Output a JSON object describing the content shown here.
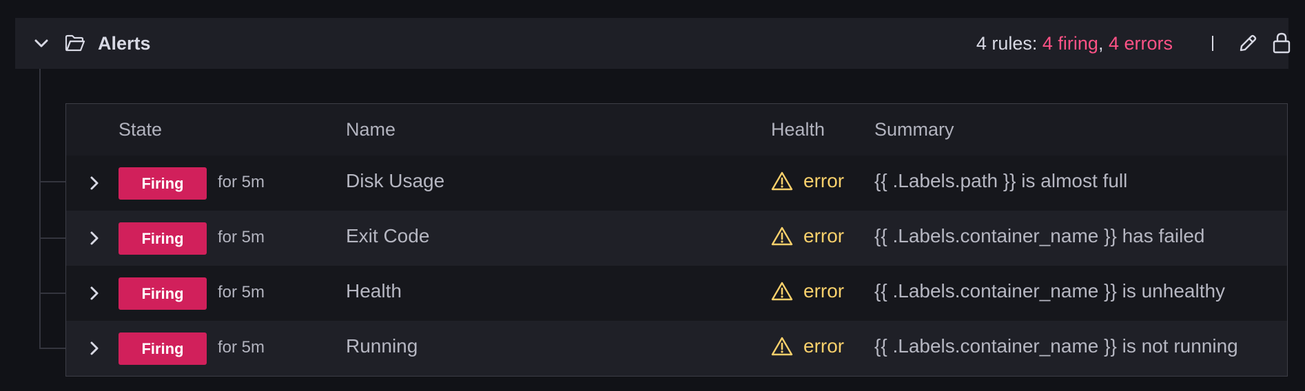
{
  "group": {
    "title": "Alerts",
    "summary_prefix": "4 rules:",
    "firing_text": "4 firing",
    "separator": ",",
    "errors_text": "4 errors"
  },
  "table": {
    "headers": {
      "state": "State",
      "name": "Name",
      "health": "Health",
      "summary": "Summary"
    },
    "rows": [
      {
        "state": "Firing",
        "duration": "for 5m",
        "name": "Disk Usage",
        "health": "error",
        "summary": "{{ .Labels.path }} is almost full"
      },
      {
        "state": "Firing",
        "duration": "for 5m",
        "name": "Exit Code",
        "health": "error",
        "summary": "{{ .Labels.container_name }} has failed"
      },
      {
        "state": "Firing",
        "duration": "for 5m",
        "name": "Health",
        "health": "error",
        "summary": "{{ .Labels.container_name }} is unhealthy"
      },
      {
        "state": "Firing",
        "duration": "for 5m",
        "name": "Running",
        "health": "error",
        "summary": "{{ .Labels.container_name }} is not running"
      }
    ]
  },
  "colors": {
    "firing": "#d1205b",
    "error_text": "#f8d06b",
    "link_red": "#ff5286"
  },
  "icons": [
    "chevron-down-icon",
    "folder-open-icon",
    "edit-icon",
    "lock-icon",
    "chevron-right-icon",
    "warning-icon"
  ]
}
